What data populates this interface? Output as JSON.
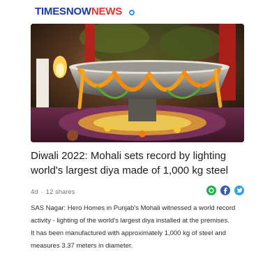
{
  "header": {
    "brand_part1": "TIMESNOW",
    "brand_part2": "NEWS"
  },
  "article": {
    "headline": "Diwali 2022: Mohali sets record by lighting world's largest diya made of 1,000 kg steel",
    "age": "4d",
    "shares": "12 shares",
    "paragraph1": "SAS Nagar: Hero Homes in Punjab's Mohali witnessed a world record activity - lighting of the world's largest diya installed at the premises.",
    "paragraph2": "It has been manufactured with approximately 1,000 kg of steel and measures 3.37 meters in diameter."
  },
  "share": {
    "whatsapp_icon": "whatsapp-icon",
    "facebook_icon": "facebook-icon",
    "twitter_icon": "twitter-icon"
  },
  "colors": {
    "brand_blue": "#1a3aa8",
    "brand_red": "#e8322d",
    "whatsapp": "#23b14d",
    "facebook": "#3b5ea8",
    "twitter": "#2fa3e8"
  }
}
